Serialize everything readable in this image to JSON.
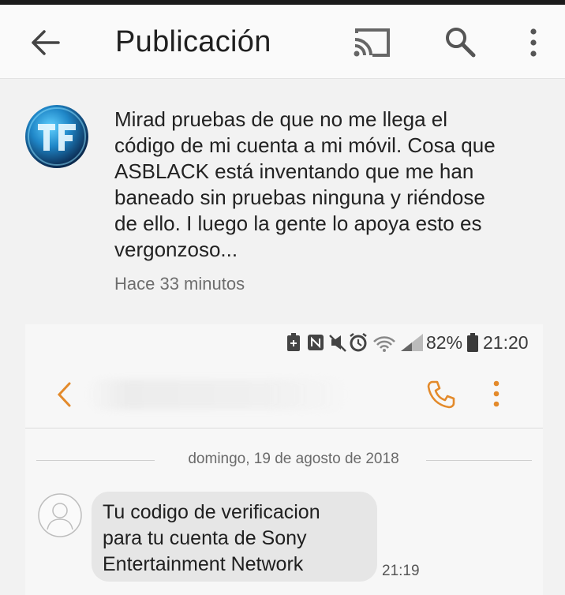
{
  "appbar": {
    "title": "Publicación",
    "icons": [
      "arrow-back-icon",
      "cast-icon",
      "search-icon",
      "more-vert-icon"
    ]
  },
  "post": {
    "avatar_icon": "profile-avatar",
    "lines": [
      "Mirad pruebas de que no me llega el",
      "código de mi cuenta a mi móvil. Cosa que",
      "ASBLACK está inventando que me han",
      "baneado sin pruebas ninguna y riéndose",
      "de ello. I luego la gente lo apoya esto es",
      "vergonzoso..."
    ],
    "time": "Hace 33 minutos"
  },
  "screenshot": {
    "status": {
      "icons": [
        "battery-saver-icon",
        "nfc-icon",
        "mute-icon",
        "alarm-icon",
        "wifi-icon",
        "signal-icon"
      ],
      "battery": "82%",
      "clock": "21:20"
    },
    "header": {
      "icons": [
        "chevron-left-icon",
        "phone-icon",
        "more-vert-icon"
      ],
      "accent": "#e38a2b"
    },
    "date": "domingo, 19 de agosto de 2018",
    "message": {
      "lines": [
        "Tu codigo de verificacion",
        "para tu cuenta de Sony",
        "Entertainment Network"
      ],
      "time": "21:19"
    }
  }
}
